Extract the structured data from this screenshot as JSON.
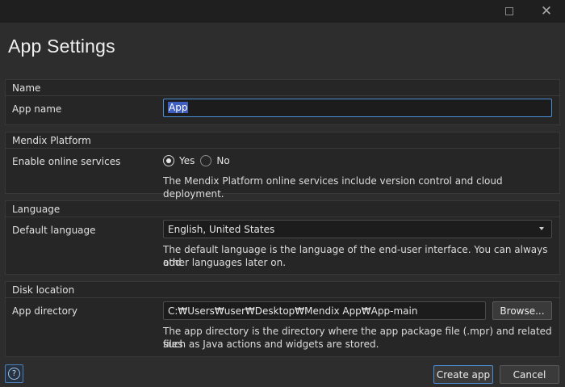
{
  "window": {
    "maximize_icon": "maximize-icon",
    "close_icon": "close-icon",
    "close_glyph": "✕"
  },
  "dialog": {
    "title": "App Settings"
  },
  "sections": {
    "name": {
      "heading": "Name",
      "app_name_label": "App name",
      "app_name_value": "App"
    },
    "platform": {
      "heading": "Mendix Platform",
      "online_label": "Enable online services",
      "option_yes": "Yes",
      "option_no": "No",
      "selected": "Yes",
      "help": "The Mendix Platform online services include version control and cloud deployment."
    },
    "language": {
      "heading": "Language",
      "default_label": "Default language",
      "selected_value": "English, United States",
      "help_line1": "The default language is the language of the end-user interface. You can always add",
      "help_line2": "other languages later on."
    },
    "disk": {
      "heading": "Disk location",
      "dir_label": "App directory",
      "dir_value": "C:₩Users₩user₩Desktop₩Mendix App₩App-main",
      "browse_label": "Browse...",
      "help_line1": "The app directory is the directory where the app package file (.mpr) and related files",
      "help_line2": "such as Java actions and widgets are stored."
    }
  },
  "footer": {
    "help_icon": "help-icon",
    "help_glyph": "?",
    "create_label": "Create app",
    "cancel_label": "Cancel"
  },
  "colors": {
    "background": "#2d2d2d",
    "titlebar": "#1f1f1f",
    "accent": "#4a8ed8",
    "selection": "#3f5fc0"
  }
}
